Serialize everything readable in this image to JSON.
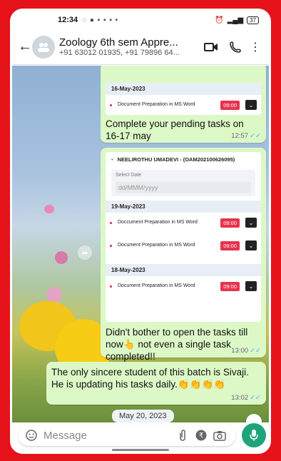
{
  "status": {
    "time": "12:34",
    "battery": "37"
  },
  "header": {
    "title": "Zoology 6th sem Appre...",
    "subtitle": "+91 63012 01935, +91 79896 64..."
  },
  "messages": {
    "m1": {
      "date": "16-May-2023",
      "task": "Document Preparation in MS Word",
      "tag": "09:00",
      "text": "Complete your pending tasks on 16-17 may",
      "time": "12:57"
    },
    "m2": {
      "student": "NEELIROTHU UMADEVI - (OAM202100626095)",
      "select_label": "Select Date",
      "select_placeholder": "dd/MMM/yyyy",
      "date1": "19-May-2023",
      "task1": "Doccument Preparation in MS Word",
      "tag1": "09:00",
      "task2": "Document Preparation in MS Word",
      "tag2": "09:00",
      "date2": "18-May-2023",
      "task3": "Document Preparation in MS Word",
      "tag3": "09:00",
      "text": "Didn't bother to open the tasks till now👆 not even a single task completed!!",
      "time": "13:00"
    },
    "m3": {
      "text": "The only sincere student of this batch is Sivaji. He is updating his tasks daily.👏👏👏👏",
      "time": "13:02"
    }
  },
  "date_pill": "May 20, 2023",
  "composer": {
    "placeholder": "Message"
  },
  "colors": {
    "frame": "#e5121a",
    "bubble": "#dcf8c6",
    "accent": "#1ea37a",
    "tag": "#e7334d"
  }
}
